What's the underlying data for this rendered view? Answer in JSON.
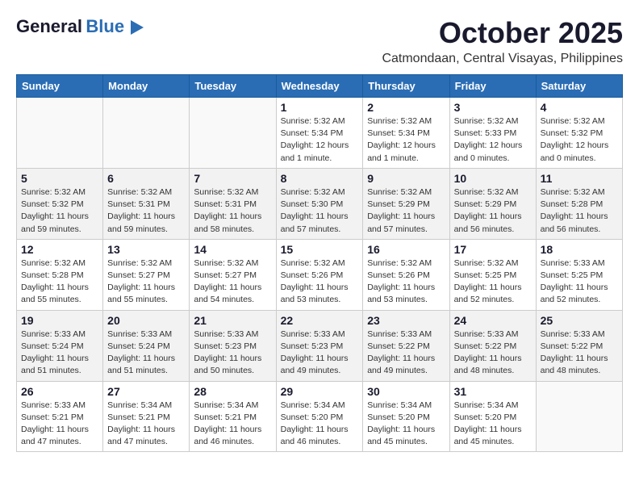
{
  "header": {
    "logo_line1": "General",
    "logo_line2": "Blue",
    "month": "October 2025",
    "location": "Catmondaan, Central Visayas, Philippines"
  },
  "weekdays": [
    "Sunday",
    "Monday",
    "Tuesday",
    "Wednesday",
    "Thursday",
    "Friday",
    "Saturday"
  ],
  "weeks": [
    [
      {
        "day": "",
        "info": ""
      },
      {
        "day": "",
        "info": ""
      },
      {
        "day": "",
        "info": ""
      },
      {
        "day": "1",
        "info": "Sunrise: 5:32 AM\nSunset: 5:34 PM\nDaylight: 12 hours\nand 1 minute."
      },
      {
        "day": "2",
        "info": "Sunrise: 5:32 AM\nSunset: 5:34 PM\nDaylight: 12 hours\nand 1 minute."
      },
      {
        "day": "3",
        "info": "Sunrise: 5:32 AM\nSunset: 5:33 PM\nDaylight: 12 hours\nand 0 minutes."
      },
      {
        "day": "4",
        "info": "Sunrise: 5:32 AM\nSunset: 5:32 PM\nDaylight: 12 hours\nand 0 minutes."
      }
    ],
    [
      {
        "day": "5",
        "info": "Sunrise: 5:32 AM\nSunset: 5:32 PM\nDaylight: 11 hours\nand 59 minutes."
      },
      {
        "day": "6",
        "info": "Sunrise: 5:32 AM\nSunset: 5:31 PM\nDaylight: 11 hours\nand 59 minutes."
      },
      {
        "day": "7",
        "info": "Sunrise: 5:32 AM\nSunset: 5:31 PM\nDaylight: 11 hours\nand 58 minutes."
      },
      {
        "day": "8",
        "info": "Sunrise: 5:32 AM\nSunset: 5:30 PM\nDaylight: 11 hours\nand 57 minutes."
      },
      {
        "day": "9",
        "info": "Sunrise: 5:32 AM\nSunset: 5:29 PM\nDaylight: 11 hours\nand 57 minutes."
      },
      {
        "day": "10",
        "info": "Sunrise: 5:32 AM\nSunset: 5:29 PM\nDaylight: 11 hours\nand 56 minutes."
      },
      {
        "day": "11",
        "info": "Sunrise: 5:32 AM\nSunset: 5:28 PM\nDaylight: 11 hours\nand 56 minutes."
      }
    ],
    [
      {
        "day": "12",
        "info": "Sunrise: 5:32 AM\nSunset: 5:28 PM\nDaylight: 11 hours\nand 55 minutes."
      },
      {
        "day": "13",
        "info": "Sunrise: 5:32 AM\nSunset: 5:27 PM\nDaylight: 11 hours\nand 55 minutes."
      },
      {
        "day": "14",
        "info": "Sunrise: 5:32 AM\nSunset: 5:27 PM\nDaylight: 11 hours\nand 54 minutes."
      },
      {
        "day": "15",
        "info": "Sunrise: 5:32 AM\nSunset: 5:26 PM\nDaylight: 11 hours\nand 53 minutes."
      },
      {
        "day": "16",
        "info": "Sunrise: 5:32 AM\nSunset: 5:26 PM\nDaylight: 11 hours\nand 53 minutes."
      },
      {
        "day": "17",
        "info": "Sunrise: 5:32 AM\nSunset: 5:25 PM\nDaylight: 11 hours\nand 52 minutes."
      },
      {
        "day": "18",
        "info": "Sunrise: 5:33 AM\nSunset: 5:25 PM\nDaylight: 11 hours\nand 52 minutes."
      }
    ],
    [
      {
        "day": "19",
        "info": "Sunrise: 5:33 AM\nSunset: 5:24 PM\nDaylight: 11 hours\nand 51 minutes."
      },
      {
        "day": "20",
        "info": "Sunrise: 5:33 AM\nSunset: 5:24 PM\nDaylight: 11 hours\nand 51 minutes."
      },
      {
        "day": "21",
        "info": "Sunrise: 5:33 AM\nSunset: 5:23 PM\nDaylight: 11 hours\nand 50 minutes."
      },
      {
        "day": "22",
        "info": "Sunrise: 5:33 AM\nSunset: 5:23 PM\nDaylight: 11 hours\nand 49 minutes."
      },
      {
        "day": "23",
        "info": "Sunrise: 5:33 AM\nSunset: 5:22 PM\nDaylight: 11 hours\nand 49 minutes."
      },
      {
        "day": "24",
        "info": "Sunrise: 5:33 AM\nSunset: 5:22 PM\nDaylight: 11 hours\nand 48 minutes."
      },
      {
        "day": "25",
        "info": "Sunrise: 5:33 AM\nSunset: 5:22 PM\nDaylight: 11 hours\nand 48 minutes."
      }
    ],
    [
      {
        "day": "26",
        "info": "Sunrise: 5:33 AM\nSunset: 5:21 PM\nDaylight: 11 hours\nand 47 minutes."
      },
      {
        "day": "27",
        "info": "Sunrise: 5:34 AM\nSunset: 5:21 PM\nDaylight: 11 hours\nand 47 minutes."
      },
      {
        "day": "28",
        "info": "Sunrise: 5:34 AM\nSunset: 5:21 PM\nDaylight: 11 hours\nand 46 minutes."
      },
      {
        "day": "29",
        "info": "Sunrise: 5:34 AM\nSunset: 5:20 PM\nDaylight: 11 hours\nand 46 minutes."
      },
      {
        "day": "30",
        "info": "Sunrise: 5:34 AM\nSunset: 5:20 PM\nDaylight: 11 hours\nand 45 minutes."
      },
      {
        "day": "31",
        "info": "Sunrise: 5:34 AM\nSunset: 5:20 PM\nDaylight: 11 hours\nand 45 minutes."
      },
      {
        "day": "",
        "info": ""
      }
    ]
  ]
}
